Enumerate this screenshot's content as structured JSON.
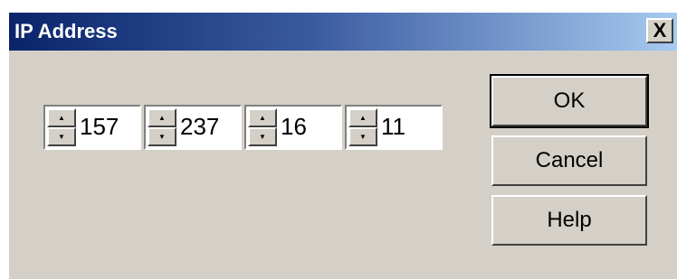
{
  "window": {
    "title": "IP Address",
    "close_label": "X"
  },
  "ip_fields": [
    {
      "value": "157"
    },
    {
      "value": "237"
    },
    {
      "value": "16"
    },
    {
      "value": "11"
    }
  ],
  "spinner": {
    "up_icon": "▲",
    "down_icon": "▼"
  },
  "buttons": {
    "ok": "OK",
    "cancel": "Cancel",
    "help": "Help"
  }
}
